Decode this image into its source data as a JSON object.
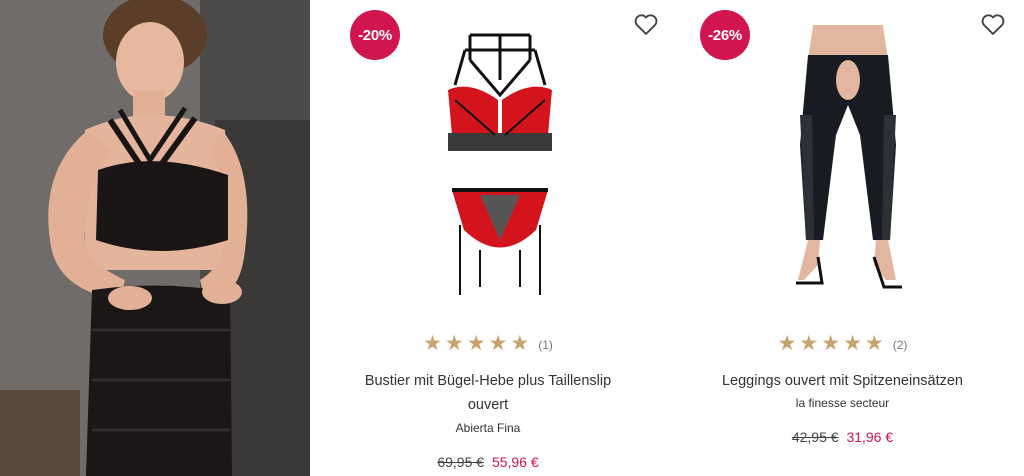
{
  "products": [
    {
      "discount": "-20%",
      "title": "Bustier mit Bügel-Hebe plus Taillenslip ouvert",
      "brand": "Abierta Fina",
      "rating_count": "(1)",
      "rating": 5,
      "old_price": "69,95 €",
      "new_price": "55,96 €",
      "wishlist_icon": "heart-outline-icon"
    },
    {
      "discount": "-26%",
      "title": "Leggings ouvert mit Spitzeneinsätzen",
      "brand": "la finesse secteur",
      "rating_count": "(2)",
      "rating": 5,
      "old_price": "42,95 €",
      "new_price": "31,96 €",
      "wishlist_icon": "heart-outline-icon"
    }
  ],
  "colors": {
    "badge": "#d0154f",
    "sale_price": "#d0154f",
    "star": "#c9a36f"
  }
}
